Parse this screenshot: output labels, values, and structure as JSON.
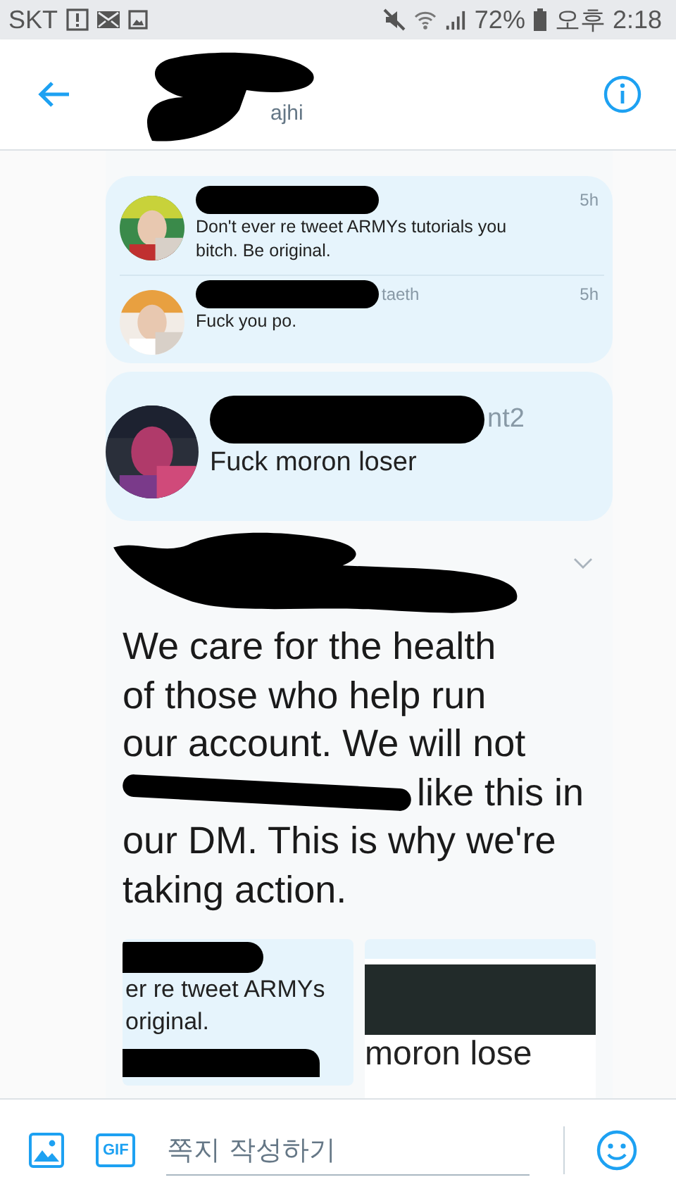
{
  "status_bar": {
    "carrier": "SKT",
    "battery": "72%",
    "time": "오후 2:18"
  },
  "header": {
    "handle": "ajhi"
  },
  "shared_image": {
    "cards": [
      {
        "kind": "compact",
        "tweets": [
          {
            "time": "5h",
            "text": "Don't ever re tweet ARMYs tutorials you bitch. Be original."
          },
          {
            "handle": "taeth",
            "time": "5h",
            "text": "Fuck you po."
          }
        ]
      },
      {
        "kind": "large",
        "tweets": [
          {
            "handle": "nt2",
            "text": "Fuck moron loser"
          }
        ]
      }
    ],
    "post": {
      "lines": [
        {
          "text": "We care for the health",
          "redacted": false
        },
        {
          "text": "of those who help run",
          "redacted": false
        },
        {
          "text": "our account. We will not",
          "redacted": false
        },
        {
          "text": "like this in",
          "redacted": true
        },
        {
          "text": "our DM. This is why we're",
          "redacted": false
        },
        {
          "text": "taking action.",
          "redacted": false
        }
      ]
    },
    "thumbnails": [
      {
        "kind": "tweet",
        "lines": [
          "er re tweet ARMYs",
          "original."
        ]
      },
      {
        "kind": "blocked",
        "lines": [
          "moron lose"
        ]
      }
    ]
  },
  "compose": {
    "gif_label": "GIF",
    "placeholder": "쪽지 작성하기"
  }
}
